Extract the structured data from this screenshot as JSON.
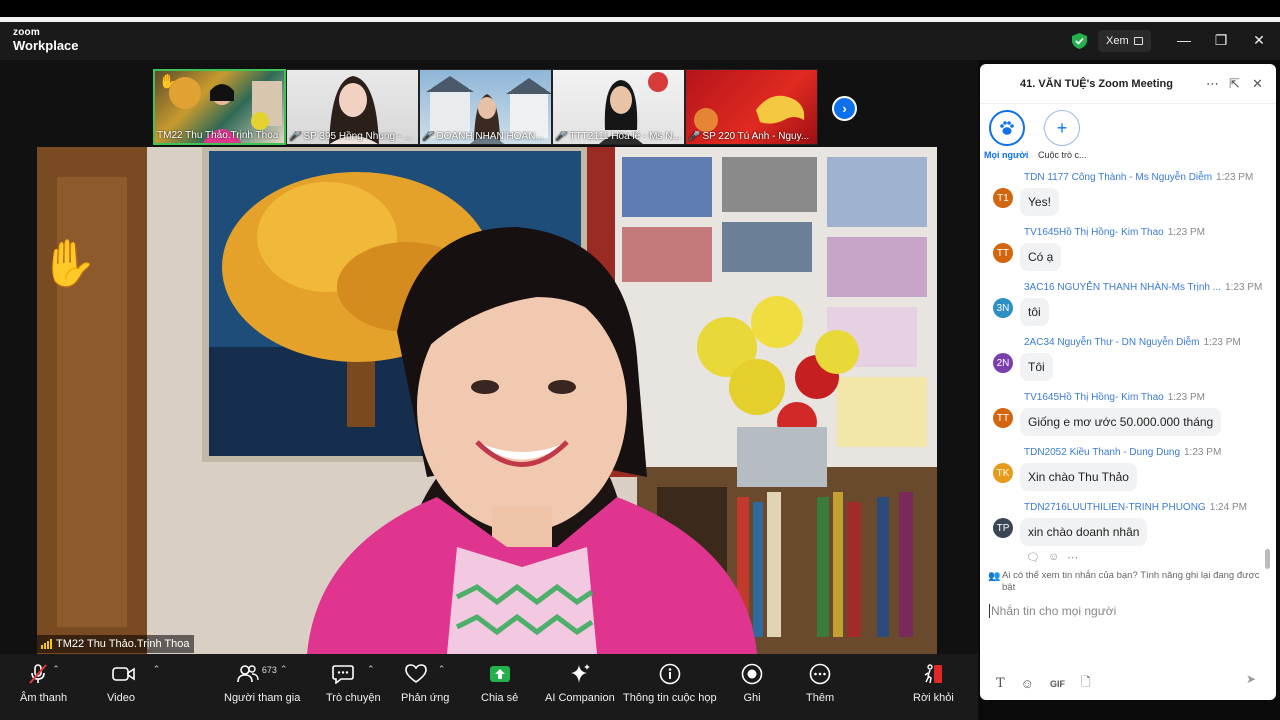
{
  "app": {
    "brand_top": "zoom",
    "brand_bottom": "Workplace",
    "view_label": "Xem"
  },
  "window": {
    "minimize": "—",
    "restore": "❐",
    "close": "✕"
  },
  "thumbnails": [
    {
      "name": "TM22 Thu Thảo.Trịnh Thoa",
      "active": true,
      "muted": false,
      "hand": true
    },
    {
      "name": "SP 395 Hồng Nhung - ...",
      "active": false,
      "muted": true
    },
    {
      "name": "DOANH NHÂN HOÀN...",
      "active": false,
      "muted": true
    },
    {
      "name": "TTT2111 Hóa lê - Ms N...",
      "active": false,
      "muted": true
    },
    {
      "name": "SP 220 Tú Anh - Nguy...",
      "active": false,
      "muted": true
    }
  ],
  "thumb_arrow": "›",
  "main_video": {
    "speaker": "TM22 Thu Thảo.Trịnh Thoa",
    "hand_icon": "✋"
  },
  "toolbar": {
    "audio": "Âm thanh",
    "video": "Video",
    "participants": "Người tham gia",
    "participants_count": "673",
    "chat": "Trò chuyện",
    "reactions": "Phản ứng",
    "share": "Chia sẻ",
    "ai": "AI Companion",
    "info": "Thông tin cuộc họp",
    "record": "Ghi",
    "more": "Thêm",
    "leave": "Rời khỏi"
  },
  "chat": {
    "title": "41. VĂN TUỆ's Zoom Meeting",
    "recipient_everyone": "Mọi người",
    "recipient_other": "Cuộc trò c...",
    "messages": [
      {
        "initials": "T1",
        "color": "#d3650f",
        "sender": "TDN 1177 Công Thành - Ms Nguyễn Diễm",
        "time": "1:23 PM",
        "text": "Yes!"
      },
      {
        "initials": "TT",
        "color": "#d3650f",
        "sender": "TV1645Hồ Thị Hồng- Kim Thao",
        "time": "1:23 PM",
        "text": "Có ạ"
      },
      {
        "initials": "3N",
        "color": "#2d8fc6",
        "sender": "3AC16 NGUYỄN THANH NHÀN-Ms Trịnh ...",
        "time": "1:23 PM",
        "text": "tôi"
      },
      {
        "initials": "2N",
        "color": "#7a3fae",
        "sender": "2AC34 Nguyễn Thư - DN Nguyễn Diễm",
        "time": "1:23 PM",
        "text": "Tôi"
      },
      {
        "initials": "TT",
        "color": "#d3650f",
        "sender": "TV1645Hồ Thị Hồng- Kim Thao",
        "time": "1:23 PM",
        "text": "Giống e mơ ước 50.000.000 tháng"
      },
      {
        "initials": "TK",
        "color": "#e89a1a",
        "sender": "TDN2052 Kiều Thanh - Dung Dung",
        "time": "1:23 PM",
        "text": "Xin chào Thu Thảo"
      },
      {
        "initials": "TP",
        "color": "#3b4654",
        "sender": "TDN2716LUUTHILIEN-TRINH PHUONG",
        "time": "1:24 PM",
        "text": "xin chào doanh nhân"
      }
    ],
    "notice": "Ai có thể xem tin nhắn của bạn? Tính năng ghi lại đang được bật",
    "input_placeholder": "Nhắn tin cho mọi người",
    "gif_label": "GIF"
  }
}
